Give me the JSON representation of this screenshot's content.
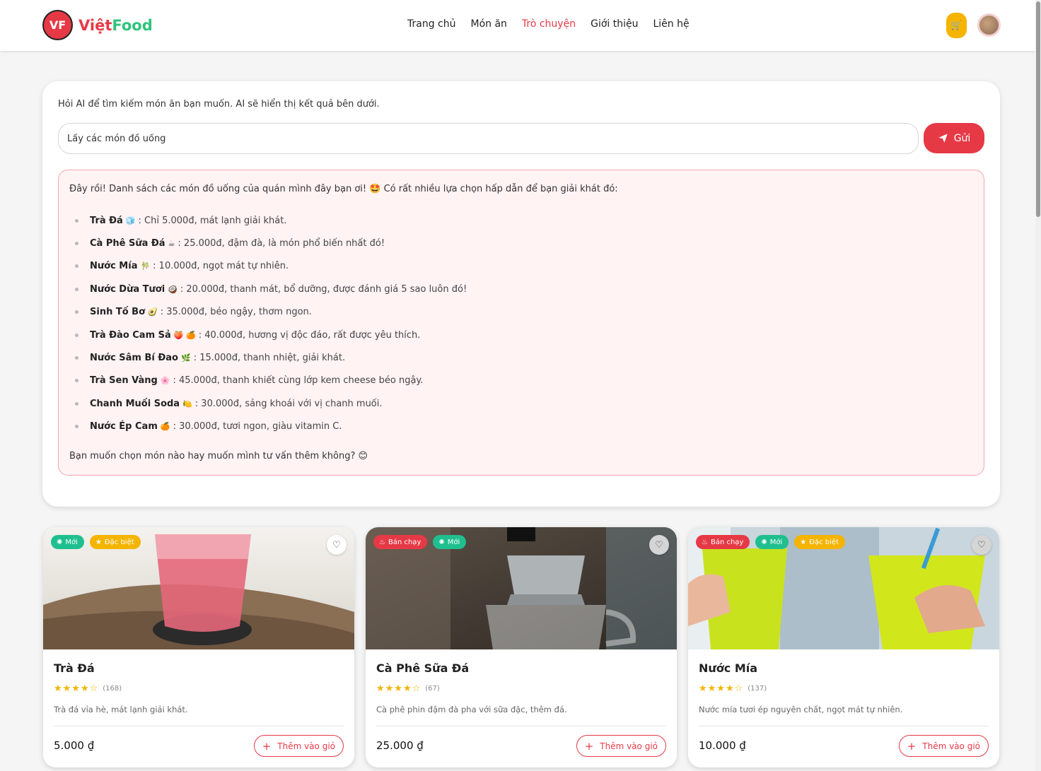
{
  "brand": {
    "badge": "VF",
    "name_a": "Việt",
    "name_b": "Food"
  },
  "nav": {
    "items": [
      "Trang chủ",
      "Món ăn",
      "Trò chuyện",
      "Giới thiệu",
      "Liên hệ"
    ],
    "active_index": 2
  },
  "header": {
    "cart_icon": "🛒"
  },
  "chat": {
    "hint": "Hỏi AI để tìm kiếm món ăn bạn muốn. AI sẽ hiển thị kết quả bên dưới.",
    "input_value": "Lấy các món đồ uống",
    "send_label": "Gửi",
    "reply": {
      "intro": "Đây rồi! Danh sách các món đồ uống của quán mình đây bạn ơi! 🤩 Có rất nhiều lựa chọn hấp dẫn để bạn giải khát đó:",
      "items": [
        {
          "name": "Trà Đá",
          "emoji": "🧊",
          "text": ": Chỉ 5.000đ, mát lạnh giải khát."
        },
        {
          "name": "Cà Phê Sữa Đá",
          "emoji": "☕",
          "text": ": 25.000đ, đậm đà, là món phổ biến nhất đó!"
        },
        {
          "name": "Nước Mía",
          "emoji": "🎋",
          "text": ": 10.000đ, ngọt mát tự nhiên."
        },
        {
          "name": "Nước Dừa Tươi",
          "emoji": "🥥",
          "text": ": 20.000đ, thanh mát, bổ dưỡng, được đánh giá 5 sao luôn đó!"
        },
        {
          "name": "Sinh Tố Bơ",
          "emoji": "🥑",
          "text": ": 35.000đ, béo ngậy, thơm ngon."
        },
        {
          "name": "Trà Đào Cam Sả",
          "emoji": "🍑 🍊",
          "text": ": 40.000đ, hương vị độc đáo, rất được yêu thích."
        },
        {
          "name": "Nước Sâm Bí Đao",
          "emoji": "🌿",
          "text": ": 15.000đ, thanh nhiệt, giải khát."
        },
        {
          "name": "Trà Sen Vàng",
          "emoji": "🌸",
          "text": ": 45.000đ, thanh khiết cùng lớp kem cheese béo ngậy."
        },
        {
          "name": "Chanh Muối Soda",
          "emoji": "🍋",
          "text": ": 30.000đ, sảng khoái với vị chanh muối."
        },
        {
          "name": "Nước Ép Cam",
          "emoji": "🍊",
          "text": ": 30.000đ, tươi ngon, giàu vitamin C."
        }
      ],
      "outro": "Bạn muốn chọn món nào hay muốn mình tư vấn thêm không? 😊"
    }
  },
  "products": [
    {
      "name": "Trà Đá",
      "stars": "★★★★☆",
      "count": "(168)",
      "desc": "Trà đá vỉa hè, mát lạnh giải khát.",
      "price": "5.000 ₫",
      "add_label": "Thêm vào giỏ",
      "badges": [
        {
          "type": "new",
          "label": "Mới"
        },
        {
          "type": "special",
          "label": "Đặc biệt"
        }
      ]
    },
    {
      "name": "Cà Phê Sữa Đá",
      "stars": "★★★★☆",
      "count": "(67)",
      "desc": "Cà phê phin đậm đà pha với sữa đặc, thêm đá.",
      "price": "25.000 ₫",
      "add_label": "Thêm vào giỏ",
      "badges": [
        {
          "type": "hot",
          "label": "Bán chạy"
        },
        {
          "type": "new",
          "label": "Mới"
        }
      ]
    },
    {
      "name": "Nước Mía",
      "stars": "★★★★☆",
      "count": "(137)",
      "desc": "Nước mía tươi ép nguyên chất, ngọt mát tự nhiên.",
      "price": "10.000 ₫",
      "add_label": "Thêm vào giỏ",
      "badges": [
        {
          "type": "hot",
          "label": "Bán chạy"
        },
        {
          "type": "new",
          "label": "Mới"
        },
        {
          "type": "special",
          "label": "Đặc biệt"
        }
      ]
    }
  ],
  "colors": {
    "accent": "#e63946",
    "brand_green": "#2ec47a",
    "star": "#f4b400",
    "badge_new": "#1fbf8f"
  }
}
